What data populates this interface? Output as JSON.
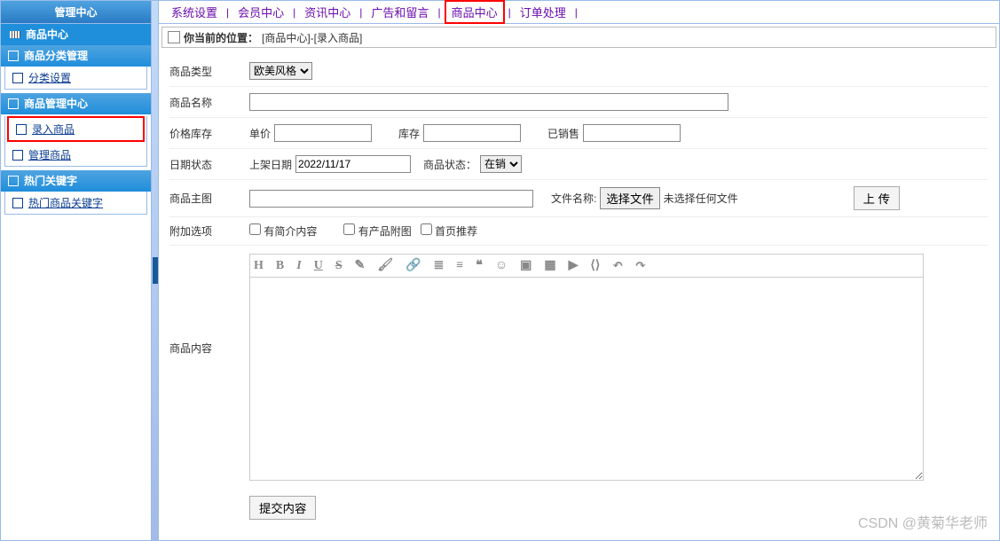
{
  "sidebar": {
    "title": "管理中心",
    "sub": "商品中心",
    "panels": [
      {
        "head": "商品分类管理",
        "items": [
          {
            "label": "分类设置",
            "hl": false
          }
        ]
      },
      {
        "head": "商品管理中心",
        "items": [
          {
            "label": "录入商品",
            "hl": true
          },
          {
            "label": "管理商品",
            "hl": false
          }
        ]
      },
      {
        "head": "热门关键字",
        "items": [
          {
            "label": "热门商品关键字",
            "hl": false
          }
        ]
      }
    ]
  },
  "topnav": {
    "items": [
      "系统设置",
      "会员中心",
      "资讯中心",
      "广告和留言",
      "商品中心",
      "订单处理"
    ],
    "highlight": "商品中心"
  },
  "breadcrumb": {
    "prefix": "你当前的位置：",
    "path": "[商品中心]-[录入商品]"
  },
  "form": {
    "type_label": "商品类型",
    "type_value": "欧美风格",
    "name_label": "商品名称",
    "name_value": "",
    "price_label": "价格库存",
    "price_unit_lbl": "单价",
    "price_unit_val": "",
    "stock_lbl": "库存",
    "stock_val": "",
    "sold_lbl": "已销售",
    "sold_val": "",
    "date_label": "日期状态",
    "date_lbl": "上架日期",
    "date_val": "2022/11/17",
    "status_lbl": "商品状态：",
    "status_val": "在销",
    "mainimg_lbl": "商品主图",
    "mainimg_val": "",
    "file_lbl": "文件名称:",
    "file_btn": "选择文件",
    "file_none": "未选择任何文件",
    "upload_btn": "上 传",
    "extra_lbl": "附加选项",
    "cb1": "有简介内容",
    "cb2": "有产品附图",
    "cb3": "首页推荐",
    "content_lbl": "商品内容",
    "submit_btn": "提交内容"
  },
  "watermark": "CSDN @黄菊华老师"
}
